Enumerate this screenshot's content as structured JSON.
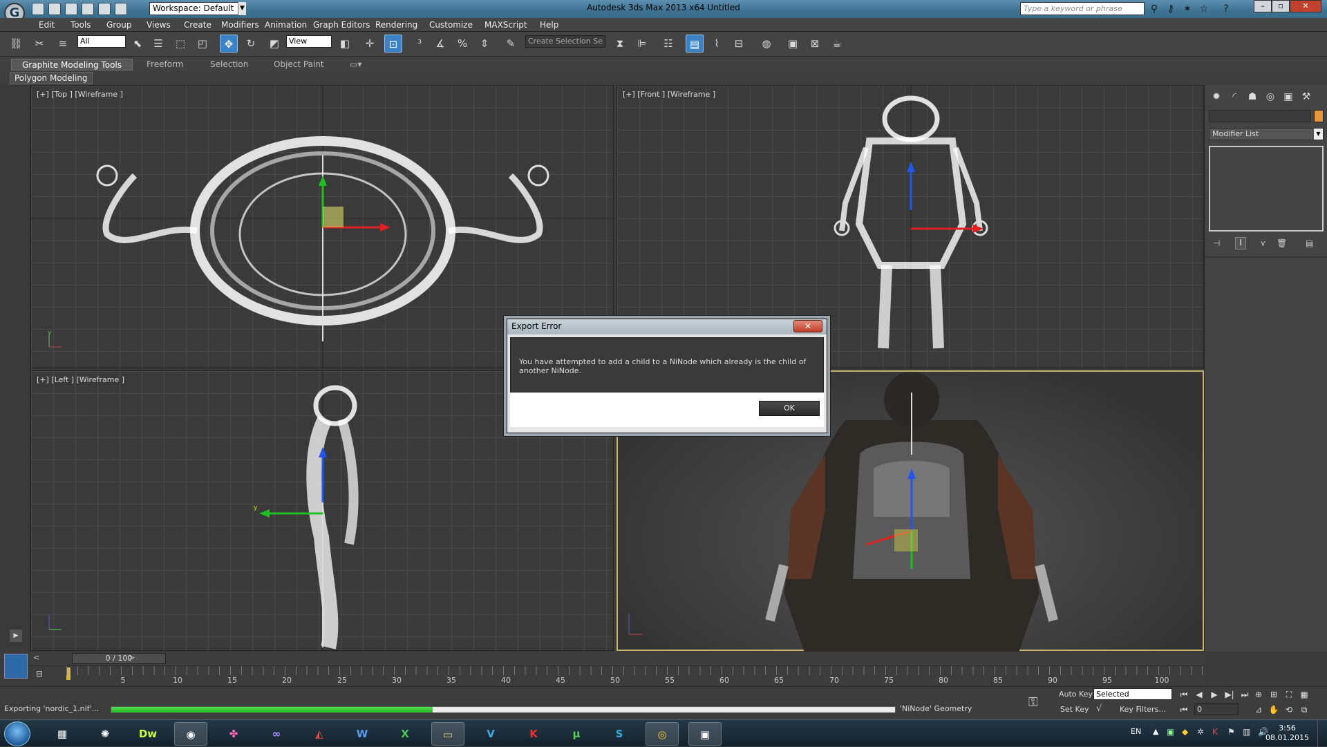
{
  "titlebar": {
    "workspace": "Workspace: Default",
    "app_title": "Autodesk 3ds Max  2013 x64      Untitled",
    "search_placeholder": "Type a keyword or phrase",
    "logo": "G"
  },
  "menu": [
    "Edit",
    "Tools",
    "Group",
    "Views",
    "Create",
    "Modifiers",
    "Animation",
    "Graph Editors",
    "Rendering",
    "Customize",
    "MAXScript",
    "Help"
  ],
  "toolbar": {
    "filter_value": "All",
    "view_value": "View",
    "selection_set_placeholder": "Create Selection Se"
  },
  "ribbon": {
    "tabs": [
      "Graphite Modeling Tools",
      "Freeform",
      "Selection",
      "Object Paint"
    ],
    "sub": "Polygon Modeling"
  },
  "viewports": {
    "top": "[+] [Top ] [Wireframe ]",
    "front": "[+] [Front ] [Wireframe ]",
    "left": "[+] [Left ] [Wireframe ]"
  },
  "command_panel": {
    "modifier_list": "Modifier List"
  },
  "timeline": {
    "slider": "0 / 100",
    "prev": "<",
    "next": ">",
    "ticks": [
      "5",
      "10",
      "15",
      "20",
      "25",
      "30",
      "35",
      "40",
      "45",
      "50",
      "55",
      "60",
      "65",
      "70",
      "75",
      "80",
      "85",
      "90",
      "95",
      "100"
    ]
  },
  "status": {
    "text": "Exporting 'nordic_1.nif'...",
    "progress": 0.41,
    "progress_label": "'NiNode' Geometry",
    "auto_key": "Auto Key",
    "auto_key_value": "Selected",
    "set_key": "Set Key",
    "key_filters": "Key Filters...",
    "frame_value": "0"
  },
  "dialog": {
    "title": "Export Error",
    "close": "✕",
    "message": "You have attempted to add a child to a NiNode which already is the child of another NiNode.",
    "ok": "OK"
  },
  "taskbar": {
    "apps": [
      "file-manager",
      "picasa",
      "dreamweaver",
      "3dsmax",
      "paint",
      "visual-studio",
      "acrobat",
      "word",
      "excel",
      "explorer",
      "vshield",
      "kaspersky",
      "utorrent",
      "skype",
      "chrome",
      "media"
    ],
    "dw_label": "Dw",
    "lang": "EN",
    "time": "3:56",
    "date": "08.01.2015"
  },
  "colors": {
    "viewport_active_border": "#c8b36a",
    "progress_green": "#1fb81f",
    "titlebar_blue": "#3f7394"
  }
}
